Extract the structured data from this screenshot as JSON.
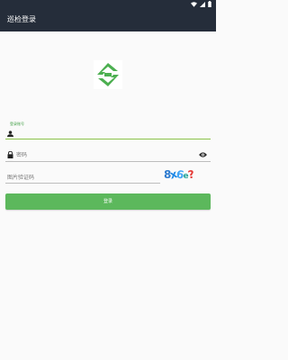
{
  "app_title": "巡检登录",
  "account_field": {
    "label": "登录账号",
    "value": ""
  },
  "password_field": {
    "placeholder": "密码"
  },
  "captcha_field": {
    "placeholder": "图片验证码",
    "captcha_text": "8x6e?"
  },
  "login_button": {
    "label": "登录"
  },
  "colors": {
    "app_bar": "#252d3a",
    "accent": "#5cb85c",
    "logo": "#4caf50"
  },
  "icons": [
    "wifi-icon",
    "signal-icon",
    "battery-icon",
    "person-icon",
    "lock-icon",
    "eye-icon",
    "logo-icon"
  ]
}
